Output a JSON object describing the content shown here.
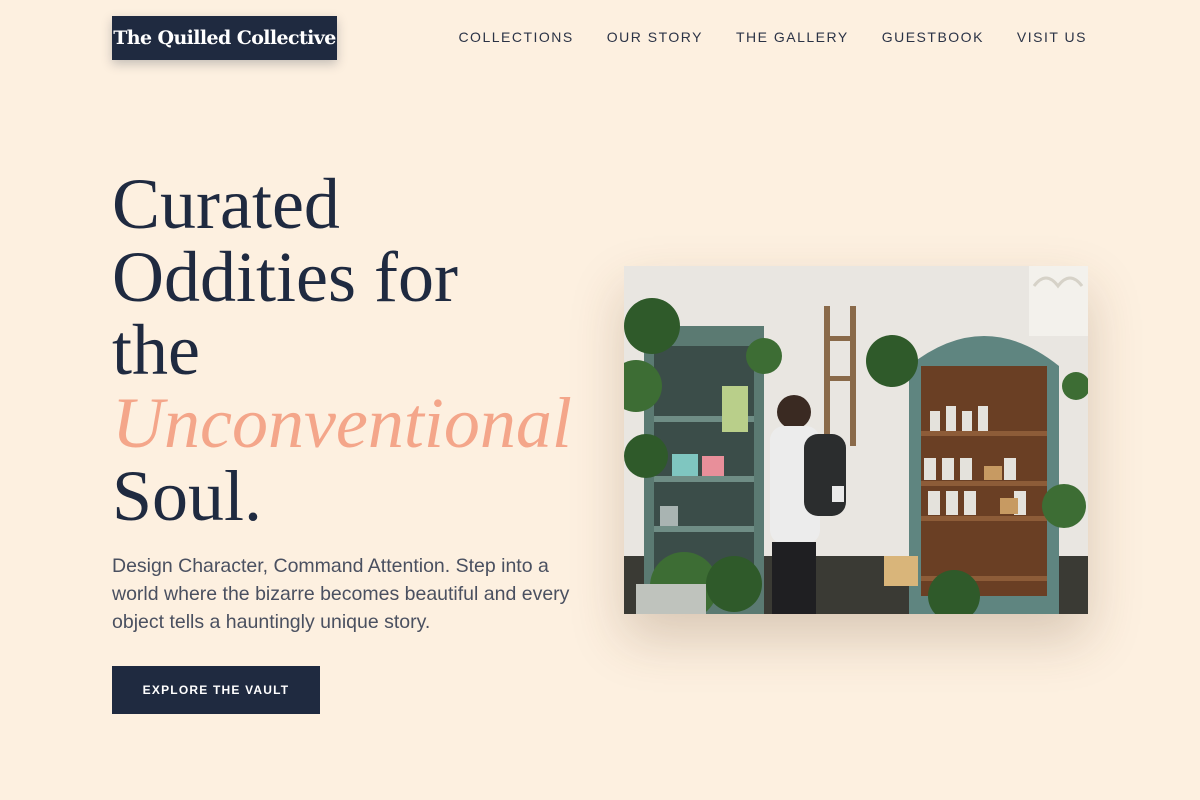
{
  "brand": {
    "name": "The Quilled Collective"
  },
  "nav": {
    "items": [
      "COLLECTIONS",
      "OUR STORY",
      "THE GALLERY",
      "GUESTBOOK",
      "VISIT US"
    ]
  },
  "hero": {
    "headline": {
      "line1": "Curated",
      "line2": "Oddities for",
      "line3": "the",
      "accent": "Unconventional",
      "line5": "Soul."
    },
    "subtext": "Design Character, Command Attention. Step into a world where the bizarre becomes beautiful and every object tells a hauntingly unique story.",
    "cta_label": "EXPLORE THE VAULT"
  },
  "colors": {
    "background": "#fdf0e0",
    "navy": "#1f2a40",
    "accent": "#f4a68a"
  }
}
